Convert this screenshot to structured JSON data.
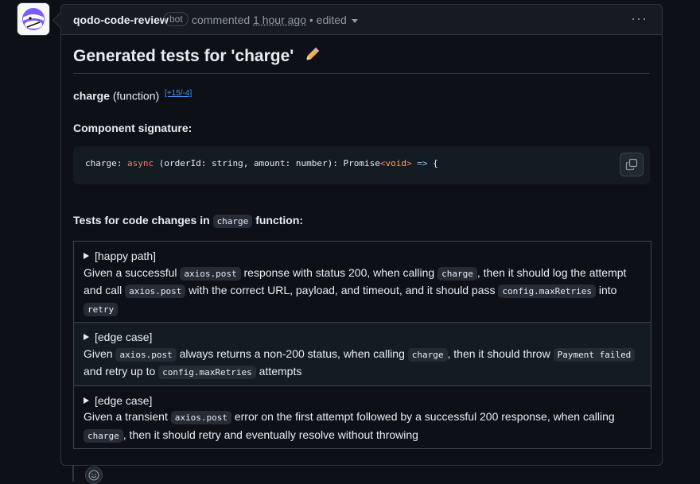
{
  "comment": {
    "author": "qodo-code-review",
    "badge": "bot",
    "action": "commented",
    "time": "1 hour ago",
    "edited": "• edited",
    "menu_icon": "kebab-horizontal-icon"
  },
  "body": {
    "title": "Generated tests for 'charge'",
    "title_icon": "pencil-icon",
    "function_name": "charge",
    "function_kind": "(function)",
    "diff_link": "[+15/-4]",
    "signature_label": "Component signature:",
    "signature_code": {
      "part1": "charge: ",
      "kw_async": "async",
      "part2": " (orderId: string, amount: number): Promise",
      "lt": "<",
      "type_void": "void",
      "gt": ">",
      "space": " ",
      "arrow": "=>",
      "part3": " {"
    },
    "tests_label_prefix": "Tests for code changes in",
    "tests_label_code": "charge",
    "tests_label_suffix": "function:",
    "copy_icon": "copy-icon"
  },
  "tests": [
    {
      "tag": "[happy path]",
      "t1": "Given a successful",
      "c1": "axios.post",
      "t2": "response with status 200, when calling",
      "c2": "charge",
      "t3": ", then it should log the attempt and call",
      "c3": "axios.post",
      "t4": "with the correct URL, payload, and timeout, and it should pass",
      "c4": "config.maxRetries",
      "t5": "into",
      "c5": "retry"
    },
    {
      "tag": "[edge case]",
      "t1": "Given",
      "c1": "axios.post",
      "t2": "always returns a non-200 status, when calling",
      "c2": "charge",
      "t3": ", then it should throw",
      "c3": "Payment failed",
      "t4": "and retry up to",
      "c4": "config.maxRetries",
      "t5": "attempts"
    },
    {
      "tag": "[edge case]",
      "t1": "Given a transient",
      "c1": "axios.post",
      "t2": "error on the first attempt followed by a successful 200 response, when calling",
      "c2": "charge",
      "t3": ", then it should retry and eventually resolve without throwing"
    }
  ],
  "footer": {
    "reaction_icon": "smiley-icon"
  }
}
